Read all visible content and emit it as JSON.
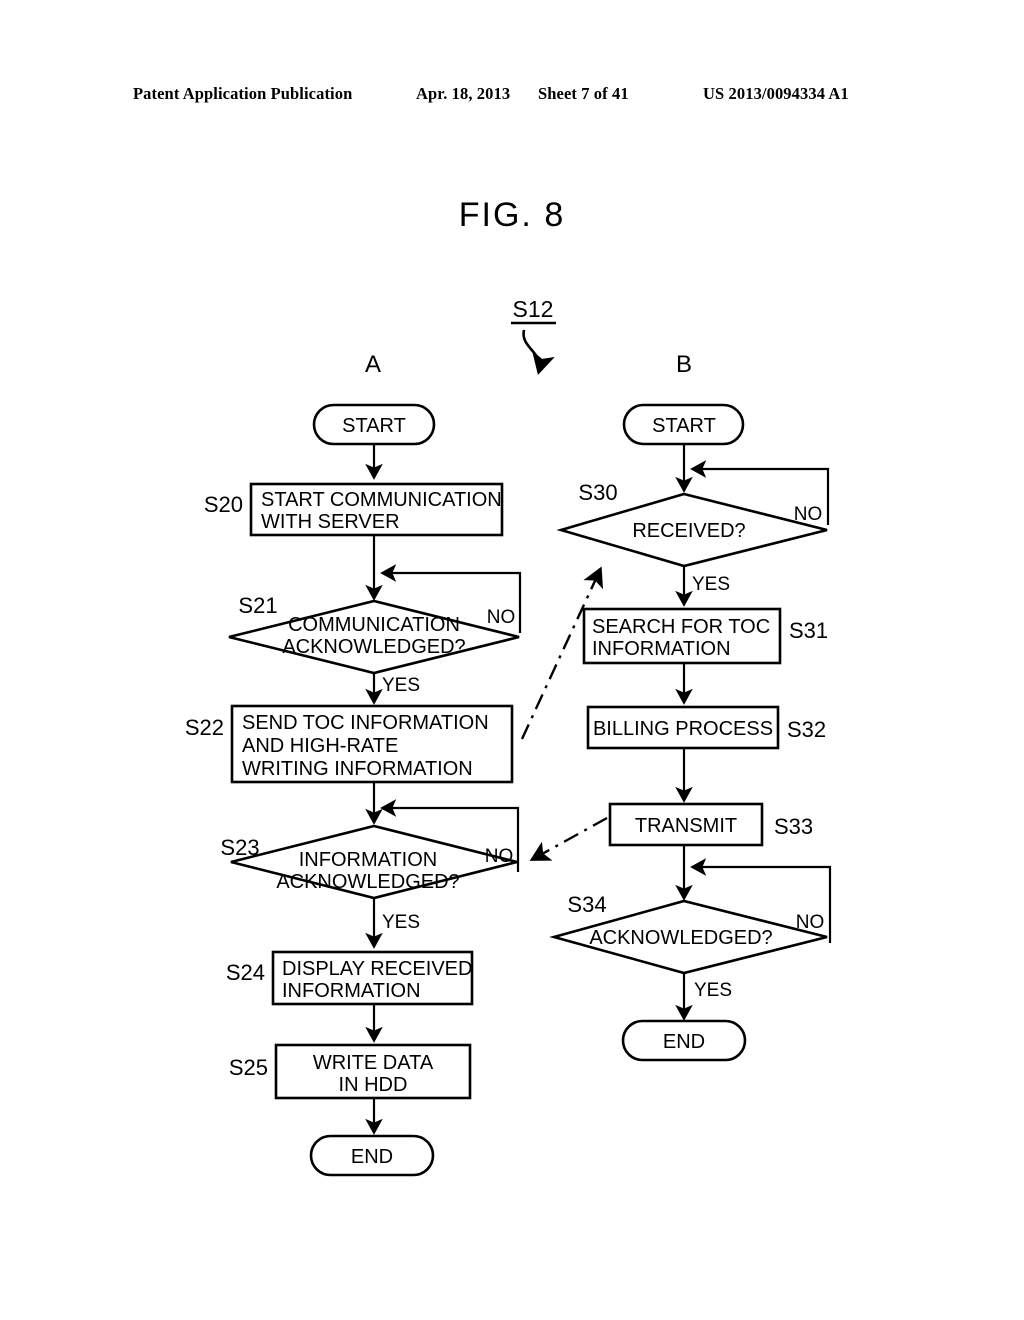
{
  "header": {
    "publication": "Patent Application Publication",
    "date": "Apr. 18, 2013",
    "sheet": "Sheet 7 of 41",
    "patent_number": "US 2013/0094334 A1"
  },
  "figure": {
    "title": "FIG. 8",
    "reference_label": "S12",
    "column_a_label": "A",
    "column_b_label": "B"
  },
  "chart_data": {
    "type": "flowchart",
    "title": "FIG. 8",
    "reference": "S12",
    "columns": [
      {
        "name": "A",
        "nodes": [
          {
            "id": "A-start",
            "shape": "terminator",
            "label": "START",
            "step": ""
          },
          {
            "id": "S20",
            "shape": "process",
            "label": "START COMMUNICATION\nWITH SERVER",
            "step": "S20"
          },
          {
            "id": "S21",
            "shape": "decision",
            "label": "COMMUNICATION\nACKNOWLEDGED?",
            "step": "S21"
          },
          {
            "id": "S22",
            "shape": "process",
            "label": "SEND TOC INFORMATION\nAND HIGH-RATE\nWRITING INFORMATION",
            "step": "S22"
          },
          {
            "id": "S23",
            "shape": "decision",
            "label": "INFORMATION\nACKNOWLEDGED?",
            "step": "S23"
          },
          {
            "id": "S24",
            "shape": "process",
            "label": "DISPLAY RECEIVED\nINFORMATION",
            "step": "S24"
          },
          {
            "id": "S25",
            "shape": "process",
            "label": "WRITE DATA\nIN HDD",
            "step": "S25"
          },
          {
            "id": "A-end",
            "shape": "terminator",
            "label": "END",
            "step": ""
          }
        ],
        "edges": [
          {
            "from": "A-start",
            "to": "S20",
            "label": ""
          },
          {
            "from": "S20",
            "to": "S21",
            "label": ""
          },
          {
            "from": "S21",
            "to": "S22",
            "label": "YES"
          },
          {
            "from": "S21",
            "to": "S21",
            "label": "NO"
          },
          {
            "from": "S22",
            "to": "S23",
            "label": ""
          },
          {
            "from": "S23",
            "to": "S24",
            "label": "YES"
          },
          {
            "from": "S23",
            "to": "S23",
            "label": "NO"
          },
          {
            "from": "S24",
            "to": "S25",
            "label": ""
          },
          {
            "from": "S25",
            "to": "A-end",
            "label": ""
          }
        ]
      },
      {
        "name": "B",
        "nodes": [
          {
            "id": "B-start",
            "shape": "terminator",
            "label": "START",
            "step": ""
          },
          {
            "id": "S30",
            "shape": "decision",
            "label": "RECEIVED?",
            "step": "S30"
          },
          {
            "id": "S31",
            "shape": "process",
            "label": "SEARCH FOR TOC\nINFORMATION",
            "step": "S31"
          },
          {
            "id": "S32",
            "shape": "process",
            "label": "BILLING PROCESS",
            "step": "S32"
          },
          {
            "id": "S33",
            "shape": "process",
            "label": "TRANSMIT",
            "step": "S33"
          },
          {
            "id": "S34",
            "shape": "decision",
            "label": "ACKNOWLEDGED?",
            "step": "S34"
          },
          {
            "id": "B-end",
            "shape": "terminator",
            "label": "END",
            "step": ""
          }
        ],
        "edges": [
          {
            "from": "B-start",
            "to": "S30",
            "label": ""
          },
          {
            "from": "S30",
            "to": "S31",
            "label": "YES"
          },
          {
            "from": "S30",
            "to": "S30",
            "label": "NO"
          },
          {
            "from": "S31",
            "to": "S32",
            "label": ""
          },
          {
            "from": "S32",
            "to": "S33",
            "label": ""
          },
          {
            "from": "S33",
            "to": "S34",
            "label": ""
          },
          {
            "from": "S34",
            "to": "B-end",
            "label": "YES"
          },
          {
            "from": "S34",
            "to": "S34",
            "label": "NO"
          }
        ]
      }
    ],
    "cross_links": [
      {
        "from": "S22",
        "to": "S30",
        "style": "dash-dot",
        "label": ""
      },
      {
        "from": "S33",
        "to": "S23",
        "style": "dash-dot",
        "label": ""
      }
    ]
  },
  "nodes": {
    "a_start": "START",
    "s20_line1": "START COMMUNICATION",
    "s20_line2": "WITH SERVER",
    "s21_line1": "COMMUNICATION",
    "s21_line2": "ACKNOWLEDGED?",
    "s22_line1": "SEND TOC INFORMATION",
    "s22_line2": "AND HIGH-RATE",
    "s22_line3": "WRITING INFORMATION",
    "s23_line1": "INFORMATION",
    "s23_line2": "ACKNOWLEDGED?",
    "s24_line1": "DISPLAY RECEIVED",
    "s24_line2": "INFORMATION",
    "s25_line1": "WRITE DATA",
    "s25_line2": "IN HDD",
    "a_end": "END",
    "b_start": "START",
    "s30_label": "RECEIVED?",
    "s31_line1": "SEARCH FOR TOC",
    "s31_line2": "INFORMATION",
    "s32_label": "BILLING PROCESS",
    "s33_label": "TRANSMIT",
    "s34_label": "ACKNOWLEDGED?",
    "b_end": "END"
  },
  "steps": {
    "s20": "S20",
    "s21": "S21",
    "s22": "S22",
    "s23": "S23",
    "s24": "S24",
    "s25": "S25",
    "s30": "S30",
    "s31": "S31",
    "s32": "S32",
    "s33": "S33",
    "s34": "S34"
  },
  "branches": {
    "s21_no": "NO",
    "s21_yes": "YES",
    "s23_no": "NO",
    "s23_yes": "YES",
    "s30_no": "NO",
    "s30_yes": "YES",
    "s34_no": "NO",
    "s34_yes": "YES"
  }
}
